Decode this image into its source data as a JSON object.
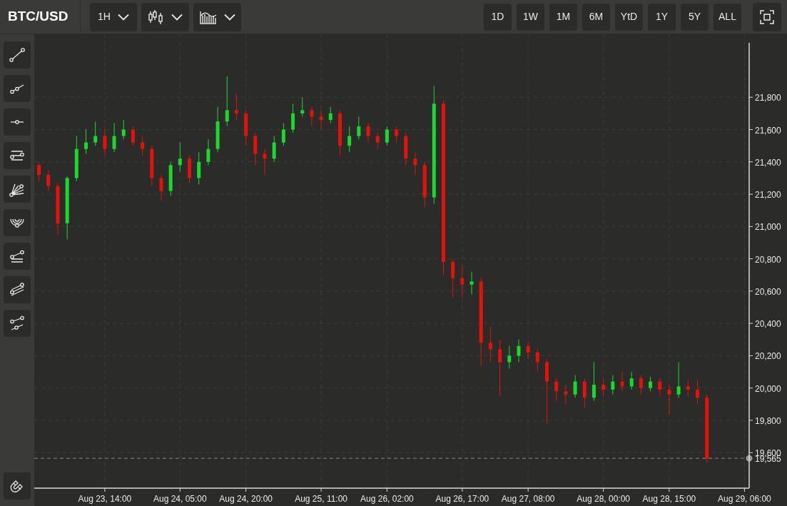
{
  "symbol": "BTC/USD",
  "toolbar": {
    "interval": {
      "label": "1H"
    },
    "chart_type": {
      "kind": "candles"
    },
    "indicators": {
      "kind": "bars"
    }
  },
  "ranges": [
    {
      "label": "1D"
    },
    {
      "label": "1W"
    },
    {
      "label": "1M"
    },
    {
      "label": "6M"
    },
    {
      "label": "YtD"
    },
    {
      "label": "1Y"
    },
    {
      "label": "5Y"
    },
    {
      "label": "ALL"
    }
  ],
  "drawing_tools": [
    {
      "kind": "line"
    },
    {
      "kind": "ray"
    },
    {
      "kind": "horizontal"
    },
    {
      "kind": "channel"
    },
    {
      "kind": "fan"
    },
    {
      "kind": "arcs"
    },
    {
      "kind": "lines"
    },
    {
      "kind": "parallel"
    },
    {
      "kind": "two-lines"
    }
  ],
  "bottom_tool": {
    "kind": "magnet"
  },
  "chart_data": {
    "type": "candlestick",
    "grid": true,
    "ylim": [
      19380,
      22190
    ],
    "yticks": [
      {
        "value": 19600,
        "label": "19,600"
      },
      {
        "value": 19800,
        "label": "19,800"
      },
      {
        "value": 20000,
        "label": "20,000"
      },
      {
        "value": 20200,
        "label": "20,200"
      },
      {
        "value": 20400,
        "label": "20,400"
      },
      {
        "value": 20600,
        "label": "20,600"
      },
      {
        "value": 20800,
        "label": "20,800"
      },
      {
        "value": 21000,
        "label": "21,000"
      },
      {
        "value": 21200,
        "label": "21,200"
      },
      {
        "value": 21400,
        "label": "21,400"
      },
      {
        "value": 21600,
        "label": "21,600"
      },
      {
        "value": 21800,
        "label": "21,800"
      }
    ],
    "categories": [
      null,
      null,
      null,
      null,
      null,
      null,
      null,
      "Aug 23, 14:00",
      null,
      null,
      null,
      null,
      null,
      null,
      null,
      "Aug 24, 05:00",
      null,
      null,
      null,
      null,
      null,
      null,
      "Aug 24, 20:00",
      null,
      null,
      null,
      null,
      null,
      null,
      null,
      "Aug 25, 11:00",
      null,
      null,
      null,
      null,
      null,
      null,
      "Aug 26, 02:00",
      null,
      null,
      null,
      null,
      null,
      null,
      null,
      "Aug 26, 17:00",
      null,
      null,
      null,
      null,
      null,
      null,
      "Aug 27, 08:00",
      null,
      null,
      null,
      null,
      null,
      null,
      null,
      "Aug 28, 00:00",
      null,
      null,
      null,
      null,
      null,
      null,
      "Aug 28, 15:00",
      null,
      null,
      null,
      null,
      null,
      null,
      null,
      "Aug 29, 06:00"
    ],
    "ohlc": [
      [
        21380,
        21400,
        21280,
        21320
      ],
      [
        21320,
        21350,
        21220,
        21250
      ],
      [
        21250,
        21270,
        20950,
        21020
      ],
      [
        21020,
        21310,
        20920,
        21300
      ],
      [
        21300,
        21560,
        21280,
        21480
      ],
      [
        21480,
        21600,
        21450,
        21520
      ],
      [
        21520,
        21650,
        21500,
        21560
      ],
      [
        21560,
        21600,
        21440,
        21480
      ],
      [
        21480,
        21640,
        21460,
        21560
      ],
      [
        21560,
        21660,
        21540,
        21600
      ],
      [
        21600,
        21620,
        21500,
        21520
      ],
      [
        21520,
        21560,
        21440,
        21480
      ],
      [
        21480,
        21500,
        21250,
        21300
      ],
      [
        21300,
        21320,
        21160,
        21220
      ],
      [
        21220,
        21400,
        21190,
        21380
      ],
      [
        21380,
        21520,
        21340,
        21420
      ],
      [
        21420,
        21440,
        21270,
        21300
      ],
      [
        21300,
        21460,
        21260,
        21400
      ],
      [
        21400,
        21540,
        21380,
        21480
      ],
      [
        21480,
        21740,
        21460,
        21650
      ],
      [
        21650,
        21930,
        21620,
        21720
      ],
      [
        21720,
        21820,
        21660,
        21700
      ],
      [
        21700,
        21720,
        21500,
        21560
      ],
      [
        21560,
        21580,
        21380,
        21450
      ],
      [
        21450,
        21480,
        21320,
        21420
      ],
      [
        21420,
        21560,
        21400,
        21520
      ],
      [
        21520,
        21640,
        21500,
        21600
      ],
      [
        21600,
        21760,
        21580,
        21700
      ],
      [
        21700,
        21800,
        21680,
        21720
      ],
      [
        21720,
        21740,
        21620,
        21680
      ],
      [
        21680,
        21720,
        21600,
        21660
      ],
      [
        21660,
        21740,
        21640,
        21700
      ],
      [
        21700,
        21720,
        21440,
        21500
      ],
      [
        21500,
        21620,
        21460,
        21560
      ],
      [
        21560,
        21680,
        21540,
        21620
      ],
      [
        21620,
        21640,
        21520,
        21560
      ],
      [
        21560,
        21580,
        21480,
        21520
      ],
      [
        21520,
        21620,
        21500,
        21600
      ],
      [
        21600,
        21620,
        21520,
        21560
      ],
      [
        21560,
        21580,
        21380,
        21420
      ],
      [
        21420,
        21460,
        21320,
        21380
      ],
      [
        21380,
        21400,
        21120,
        21180
      ],
      [
        21180,
        21870,
        21140,
        21760
      ],
      [
        21760,
        21780,
        20700,
        20780
      ],
      [
        20780,
        20800,
        20560,
        20680
      ],
      [
        20680,
        20760,
        20560,
        20640
      ],
      [
        20640,
        20720,
        20580,
        20660
      ],
      [
        20660,
        20680,
        20140,
        20280
      ],
      [
        20280,
        20380,
        20160,
        20240
      ],
      [
        20240,
        20300,
        19950,
        20160
      ],
      [
        20160,
        20260,
        20120,
        20200
      ],
      [
        20200,
        20300,
        20160,
        20260
      ],
      [
        20260,
        20280,
        20180,
        20220
      ],
      [
        20220,
        20240,
        20100,
        20160
      ],
      [
        20160,
        20180,
        19780,
        20040
      ],
      [
        20040,
        20060,
        19920,
        19980
      ],
      [
        19980,
        20020,
        19900,
        19960
      ],
      [
        19960,
        20080,
        19940,
        20040
      ],
      [
        20040,
        20060,
        19880,
        19940
      ],
      [
        19940,
        20160,
        19920,
        20020
      ],
      [
        20020,
        20060,
        19950,
        19990
      ],
      [
        19990,
        20080,
        19960,
        20040
      ],
      [
        20040,
        20100,
        19980,
        20010
      ],
      [
        20010,
        20100,
        19990,
        20060
      ],
      [
        20060,
        20080,
        19960,
        20000
      ],
      [
        20000,
        20070,
        19980,
        20040
      ],
      [
        20040,
        20060,
        19950,
        19990
      ],
      [
        19990,
        20020,
        19840,
        19960
      ],
      [
        19960,
        20160,
        19940,
        20010
      ],
      [
        20010,
        20050,
        19950,
        19990
      ],
      [
        19990,
        20050,
        19900,
        19940
      ],
      [
        19940,
        19960,
        19540,
        19565
      ],
      null,
      null,
      null,
      null
    ],
    "ref_lines": [
      {
        "axis": "y",
        "value": 19565,
        "label": "19,565"
      }
    ]
  }
}
